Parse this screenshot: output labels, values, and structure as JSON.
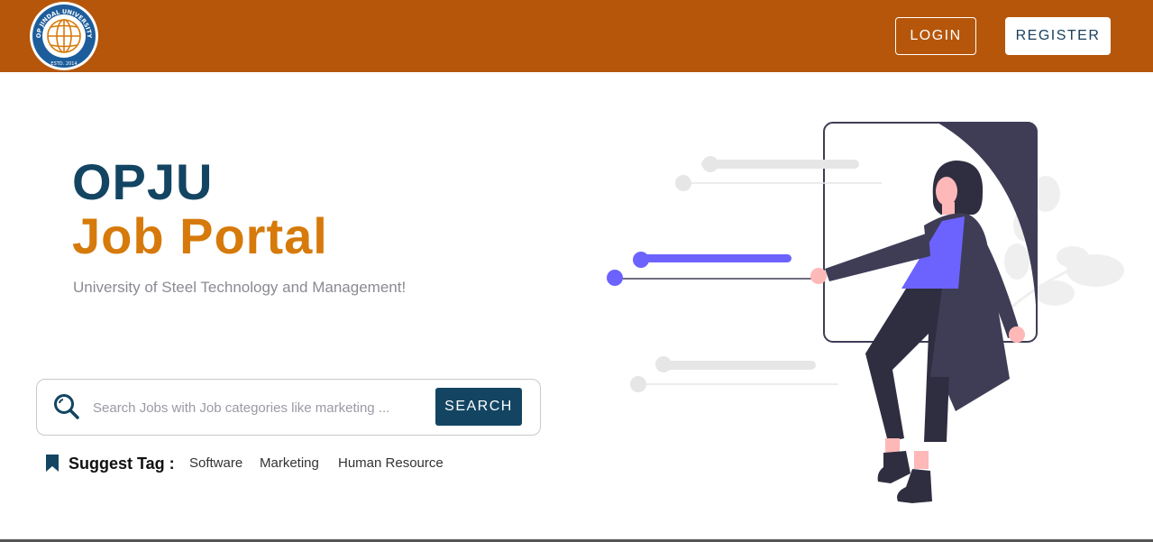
{
  "header": {
    "logo_text_top": "OP JINDAL UNIVERSITY",
    "logo_text_bottom": "ESTD. 2014",
    "login_label": "LOGIN",
    "register_label": "REGISTER"
  },
  "hero": {
    "title_line1": "OPJU",
    "title_line2": "Job Portal",
    "subtitle": "University of Steel Technology and Management!"
  },
  "search": {
    "placeholder": "Search Jobs with Job categories like marketing ...",
    "value": "",
    "button_label": "SEARCH"
  },
  "suggest": {
    "label": "Suggest Tag :",
    "tags": [
      "Software",
      "Marketing",
      "Human Resource"
    ]
  },
  "colors": {
    "header_bg": "#b5560b",
    "primary_blue": "#134563",
    "accent_orange": "#d67a0b",
    "illustration_purple": "#6c63ff",
    "illustration_dark": "#3f3d56"
  },
  "icons": {
    "search": "search-icon",
    "bookmark": "bookmark-icon",
    "logo": "university-logo"
  }
}
